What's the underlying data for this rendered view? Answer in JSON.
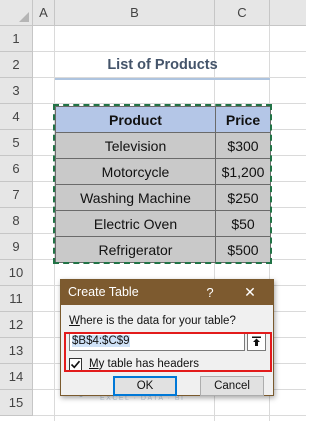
{
  "columns": [
    "A",
    "B",
    "C"
  ],
  "rows": [
    "1",
    "2",
    "3",
    "4",
    "5",
    "6",
    "7",
    "8",
    "9",
    "10",
    "11",
    "12",
    "13",
    "14",
    "15"
  ],
  "sheet_title": "List of Products",
  "table": {
    "headers": [
      "Product",
      "Price"
    ],
    "rows": [
      [
        "Television",
        "$300"
      ],
      [
        "Motorcycle",
        "$1,200"
      ],
      [
        "Washing Machine",
        "$250"
      ],
      [
        "Electric Oven",
        "$50"
      ],
      [
        "Refrigerator",
        "$500"
      ]
    ]
  },
  "dialog": {
    "title": "Create Table",
    "help": "?",
    "close": "✕",
    "prompt_underlined": "W",
    "prompt_rest": "here is the data for your table?",
    "range_value": "$B$4:$C$9",
    "checkbox_checked": true,
    "checkbox_underlined": "M",
    "checkbox_rest": "y table has headers",
    "ok_label": "OK",
    "cancel_label": "Cancel"
  },
  "watermark": {
    "name": "exceldemy",
    "tagline": "EXCEL · DATA · BI"
  },
  "colors": {
    "header_fill": "#b4c6e7",
    "cell_fill": "#c9c9c9",
    "title_text": "#44546a",
    "dialog_titlebar": "#7d5a2f",
    "highlight": "#e21b1b",
    "selection_border": "#217346"
  }
}
